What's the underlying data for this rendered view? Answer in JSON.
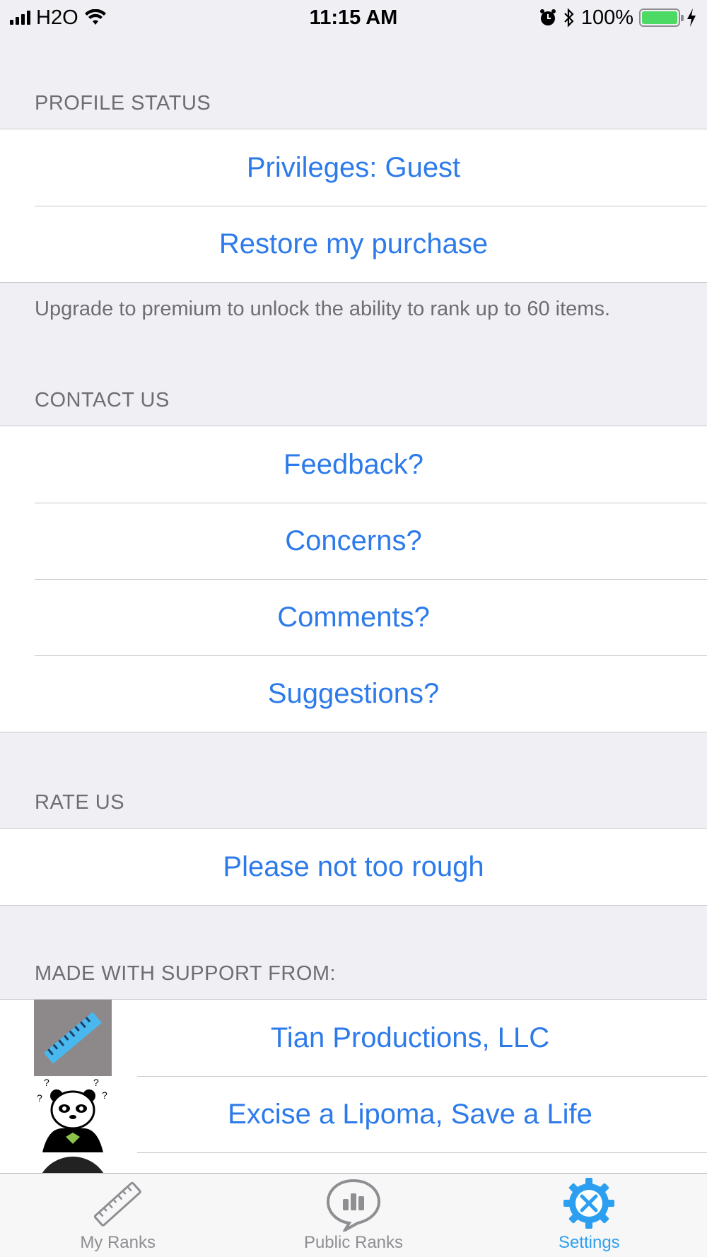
{
  "status_bar": {
    "carrier": "H2O",
    "time": "11:15 AM",
    "battery": "100%"
  },
  "profile_status": {
    "header": "PROFILE STATUS",
    "rows": [
      "Privileges: Guest",
      "Restore my purchase"
    ],
    "footer": "Upgrade to premium to unlock the ability to rank up to 60 items."
  },
  "contact_us": {
    "header": "CONTACT US",
    "rows": [
      "Feedback?",
      "Concerns?",
      "Comments?",
      "Suggestions?"
    ]
  },
  "rate_us": {
    "header": "RATE US",
    "rows": [
      "Please not too rough"
    ]
  },
  "support": {
    "header": "MADE WITH SUPPORT FROM:",
    "rows": [
      "Tian Productions, LLC",
      "Excise a Lipoma, Save a Life"
    ]
  },
  "tab_bar": {
    "tabs": [
      {
        "label": "My Ranks",
        "icon": "ruler-icon"
      },
      {
        "label": "Public Ranks",
        "icon": "chart-bubble-icon"
      },
      {
        "label": "Settings",
        "icon": "gear-tools-icon"
      }
    ],
    "active_color": "#2d9ff0",
    "inactive_color": "#8e8e93"
  },
  "colors": {
    "link": "#2d7bea",
    "background": "#efeff4"
  }
}
